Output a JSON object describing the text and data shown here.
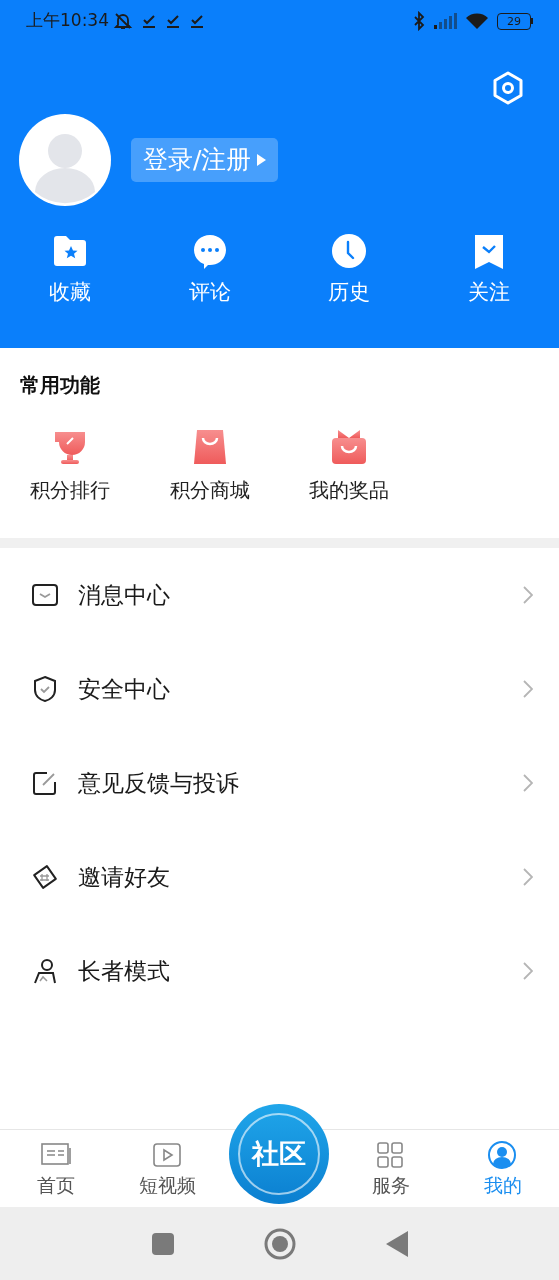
{
  "status_bar": {
    "time": "上午10:34",
    "battery": "29"
  },
  "profile": {
    "login_label": "登录/注册"
  },
  "quick_actions": [
    {
      "label": "收藏"
    },
    {
      "label": "评论"
    },
    {
      "label": "历史"
    },
    {
      "label": "关注"
    }
  ],
  "common_functions": {
    "title": "常用功能",
    "items": [
      {
        "label": "积分排行"
      },
      {
        "label": "积分商城"
      },
      {
        "label": "我的奖品"
      }
    ]
  },
  "menu": [
    {
      "label": "消息中心"
    },
    {
      "label": "安全中心"
    },
    {
      "label": "意见反馈与投诉"
    },
    {
      "label": "邀请好友"
    },
    {
      "label": "长者模式"
    }
  ],
  "bottom_nav": [
    {
      "label": "首页",
      "kind": "tab",
      "selected": false
    },
    {
      "label": "短视频",
      "kind": "tab",
      "selected": false
    },
    {
      "label": "社区",
      "kind": "feature",
      "selected": false
    },
    {
      "label": "服务",
      "kind": "tab",
      "selected": false
    },
    {
      "label": "我的",
      "kind": "tab",
      "selected": true
    }
  ]
}
